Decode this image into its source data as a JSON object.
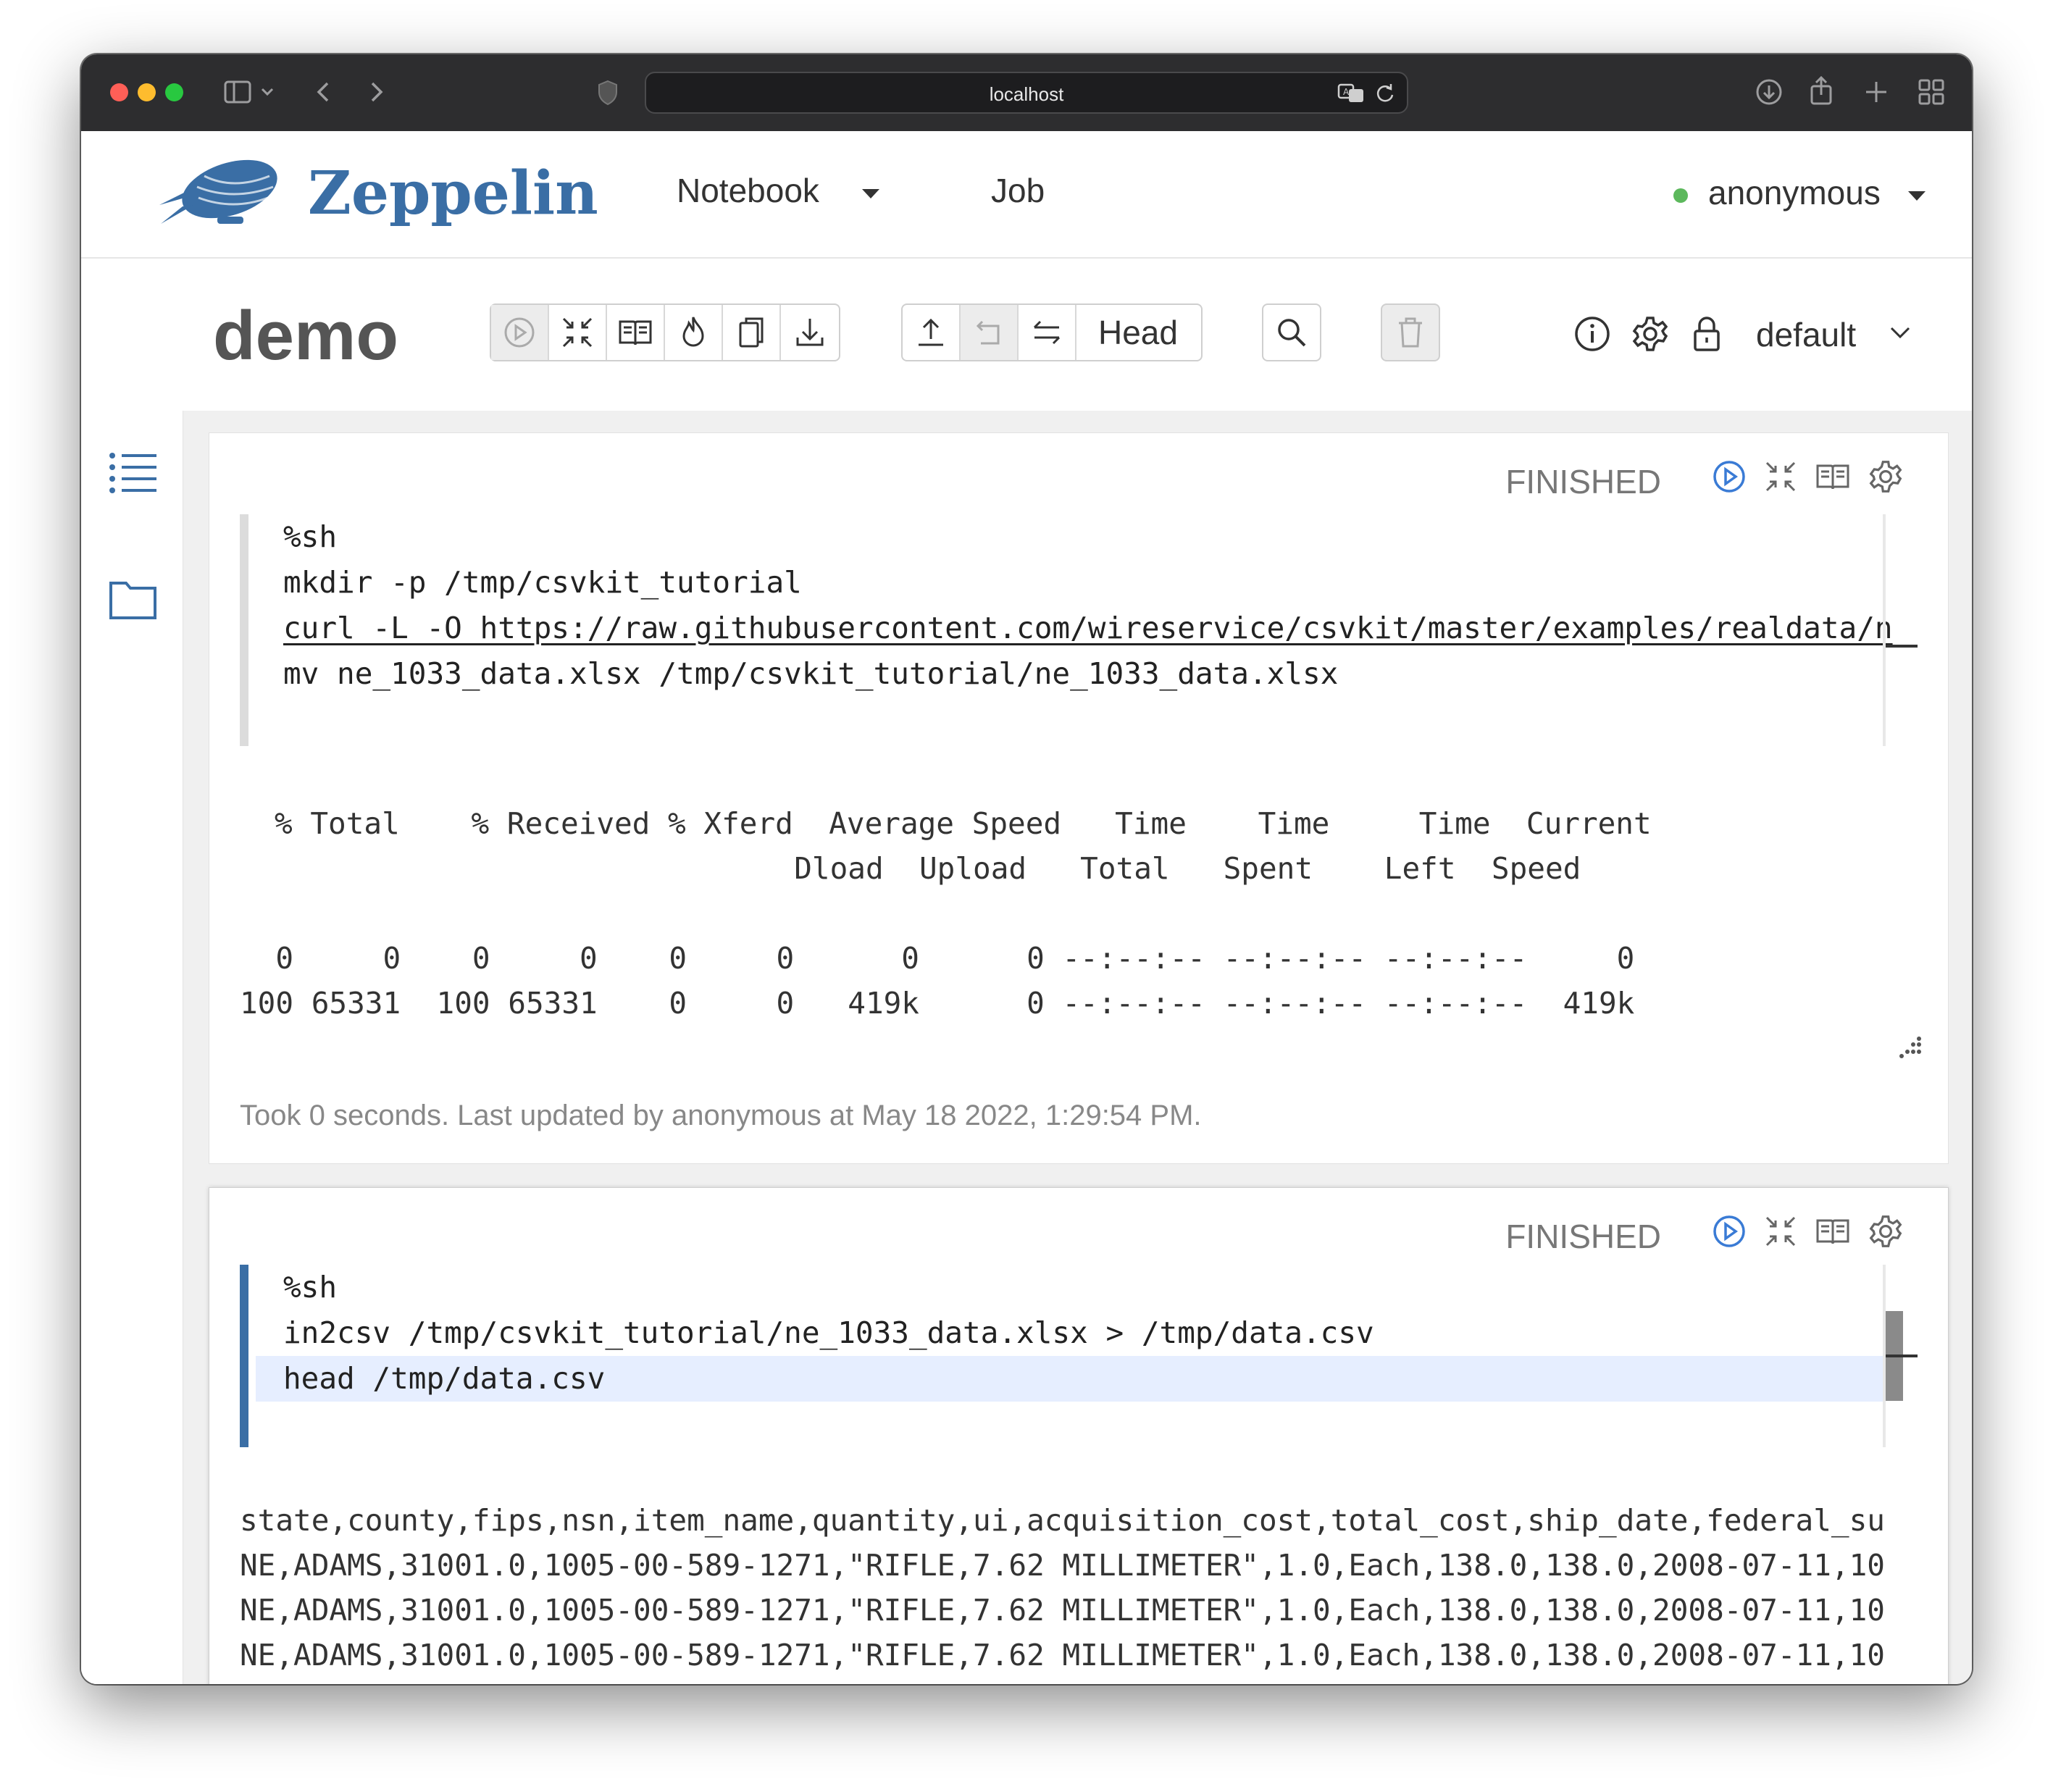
{
  "browser": {
    "url": "localhost"
  },
  "nav": {
    "brand": "Zeppelin",
    "menu_notebook": "Notebook",
    "menu_job": "Job",
    "user": "anonymous"
  },
  "notebook": {
    "title": "demo",
    "head_label": "Head",
    "interpreter": "default"
  },
  "paragraphs": [
    {
      "status": "FINISHED",
      "code": [
        "%sh",
        "mkdir -p /tmp/csvkit_tutorial",
        "curl -L -O https://raw.githubusercontent.com/wireservice/csvkit/master/examples/realdata/n",
        "mv ne_1033_data.xlsx /tmp/csvkit_tutorial/ne_1033_data.xlsx"
      ],
      "output": [
        "% Total    % Received % Xferd  Average Speed   Time    Time     Time  Current",
        "                               Dload  Upload   Total   Spent    Left  Speed",
        "",
        "  0     0    0     0    0     0      0      0 --:--:-- --:--:-- --:--:--     0",
        "100 65331  100 65331    0     0   419k      0 --:--:-- --:--:-- --:--:--  419k"
      ],
      "footer": "Took 0 seconds. Last updated by anonymous at May 18 2022, 1:29:54 PM."
    },
    {
      "status": "FINISHED",
      "code": [
        "%sh",
        "in2csv /tmp/csvkit_tutorial/ne_1033_data.xlsx > /tmp/data.csv",
        "head /tmp/data.csv"
      ],
      "output": [
        "state,county,fips,nsn,item_name,quantity,ui,acquisition_cost,total_cost,ship_date,federal_su",
        "NE,ADAMS,31001.0,1005-00-589-1271,\"RIFLE,7.62 MILLIMETER\",1.0,Each,138.0,138.0,2008-07-11,10",
        "NE,ADAMS,31001.0,1005-00-589-1271,\"RIFLE,7.62 MILLIMETER\",1.0,Each,138.0,138.0,2008-07-11,10",
        "NE,ADAMS,31001.0,1005-00-589-1271,\"RIFLE,7.62 MILLIMETER\",1.0,Each,138.0,138.0,2008-07-11,10"
      ]
    }
  ],
  "colors": {
    "brand": "#3a6ea5",
    "run_icon": "#3a7bd5",
    "active_bar": "#3a6ea5",
    "status_online": "#5cb85c"
  }
}
